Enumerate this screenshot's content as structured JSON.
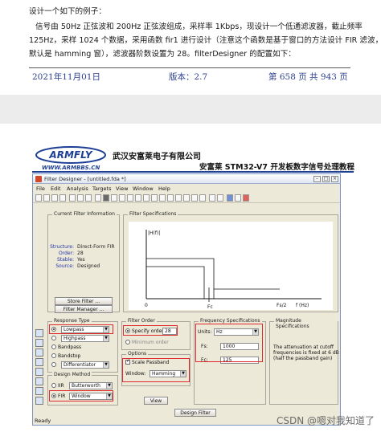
{
  "doc": {
    "para_lines": [
      "设计一个如下的例子：",
      "信号由 50Hz 正弦波和 200Hz 正弦波组成，采样率 1Kbps，现设计一个低通滤波器，截止频率",
      "125Hz，采样 1024 个数据，采用函数 fir1 进行设计（注意这个函数是基于窗口的方法设计 FIR 滤波，",
      "默认是 hamming 窗），滤波器阶数设置为 28。filterDesigner 的配置如下："
    ],
    "footer": {
      "date": "2021年11月01日",
      "version": "版本：2.7",
      "pages": "第 658 页 共 943 页"
    },
    "header": {
      "logo_text": "ARMFLY",
      "logo_url": "WWW.ARMBBS.CN",
      "company": "武汉安富莱电子有限公司",
      "book_title": "安富莱 STM32-V7 开发板数字信号处理教程"
    },
    "watermark": "CSDN @嗯对我知道了"
  },
  "app": {
    "title": "Filter Designer - [untitled.fda *]",
    "menu": [
      "File",
      "Edit",
      "Analysis",
      "Targets",
      "View",
      "Window",
      "Help"
    ],
    "current_filter": {
      "title": "Current Filter Information",
      "rows": [
        {
          "k": "Structure:",
          "v": "Direct-Form FIR"
        },
        {
          "k": "Order:",
          "v": "28"
        },
        {
          "k": "Stable:",
          "v": "Yes"
        },
        {
          "k": "Source:",
          "v": "Designed"
        }
      ],
      "store_btn": "Store Filter ...",
      "manager_btn": "Filter Manager ..."
    },
    "filter_specs": {
      "title": "Filter Specifications",
      "ylabel": "|H(f)|",
      "ticks": [
        "0",
        "Fc",
        "Fs/2",
        "f (Hz)"
      ]
    },
    "response_type": {
      "title": "Response Type",
      "options": [
        "Lowpass",
        "Highpass",
        "Bandpass",
        "Bandstop",
        "Differentiator"
      ],
      "lowpass_value": "Lowpass",
      "highpass_value": "Highpass",
      "diff_value": "Differentiator"
    },
    "design_method": {
      "title": "Design Method",
      "iir_label": "IIR",
      "iir_value": "Butterworth",
      "fir_label": "FIR",
      "fir_value": "Window"
    },
    "filter_order": {
      "title": "Filter Order",
      "specify_label": "Specify order:",
      "specify_value": "28",
      "minimum_label": "Minimum order"
    },
    "options": {
      "title": "Options",
      "scale_label": "Scale Passband",
      "window_label": "Window:",
      "window_value": "Hamming",
      "view_btn": "View"
    },
    "freq_specs": {
      "title": "Frequency Specifications",
      "units_label": "Units:",
      "units_value": "Hz",
      "fs_label": "Fs:",
      "fs_value": "1000",
      "fc_label": "Fc:",
      "fc_value": "125"
    },
    "mag_specs": {
      "title": "Magnitude Specifications",
      "note": [
        "The attenuation at cutoff",
        "frequencies is fixed at 6 dB",
        "(half the passband gain)"
      ]
    },
    "design_btn": "Design Filter",
    "status": "Ready"
  }
}
